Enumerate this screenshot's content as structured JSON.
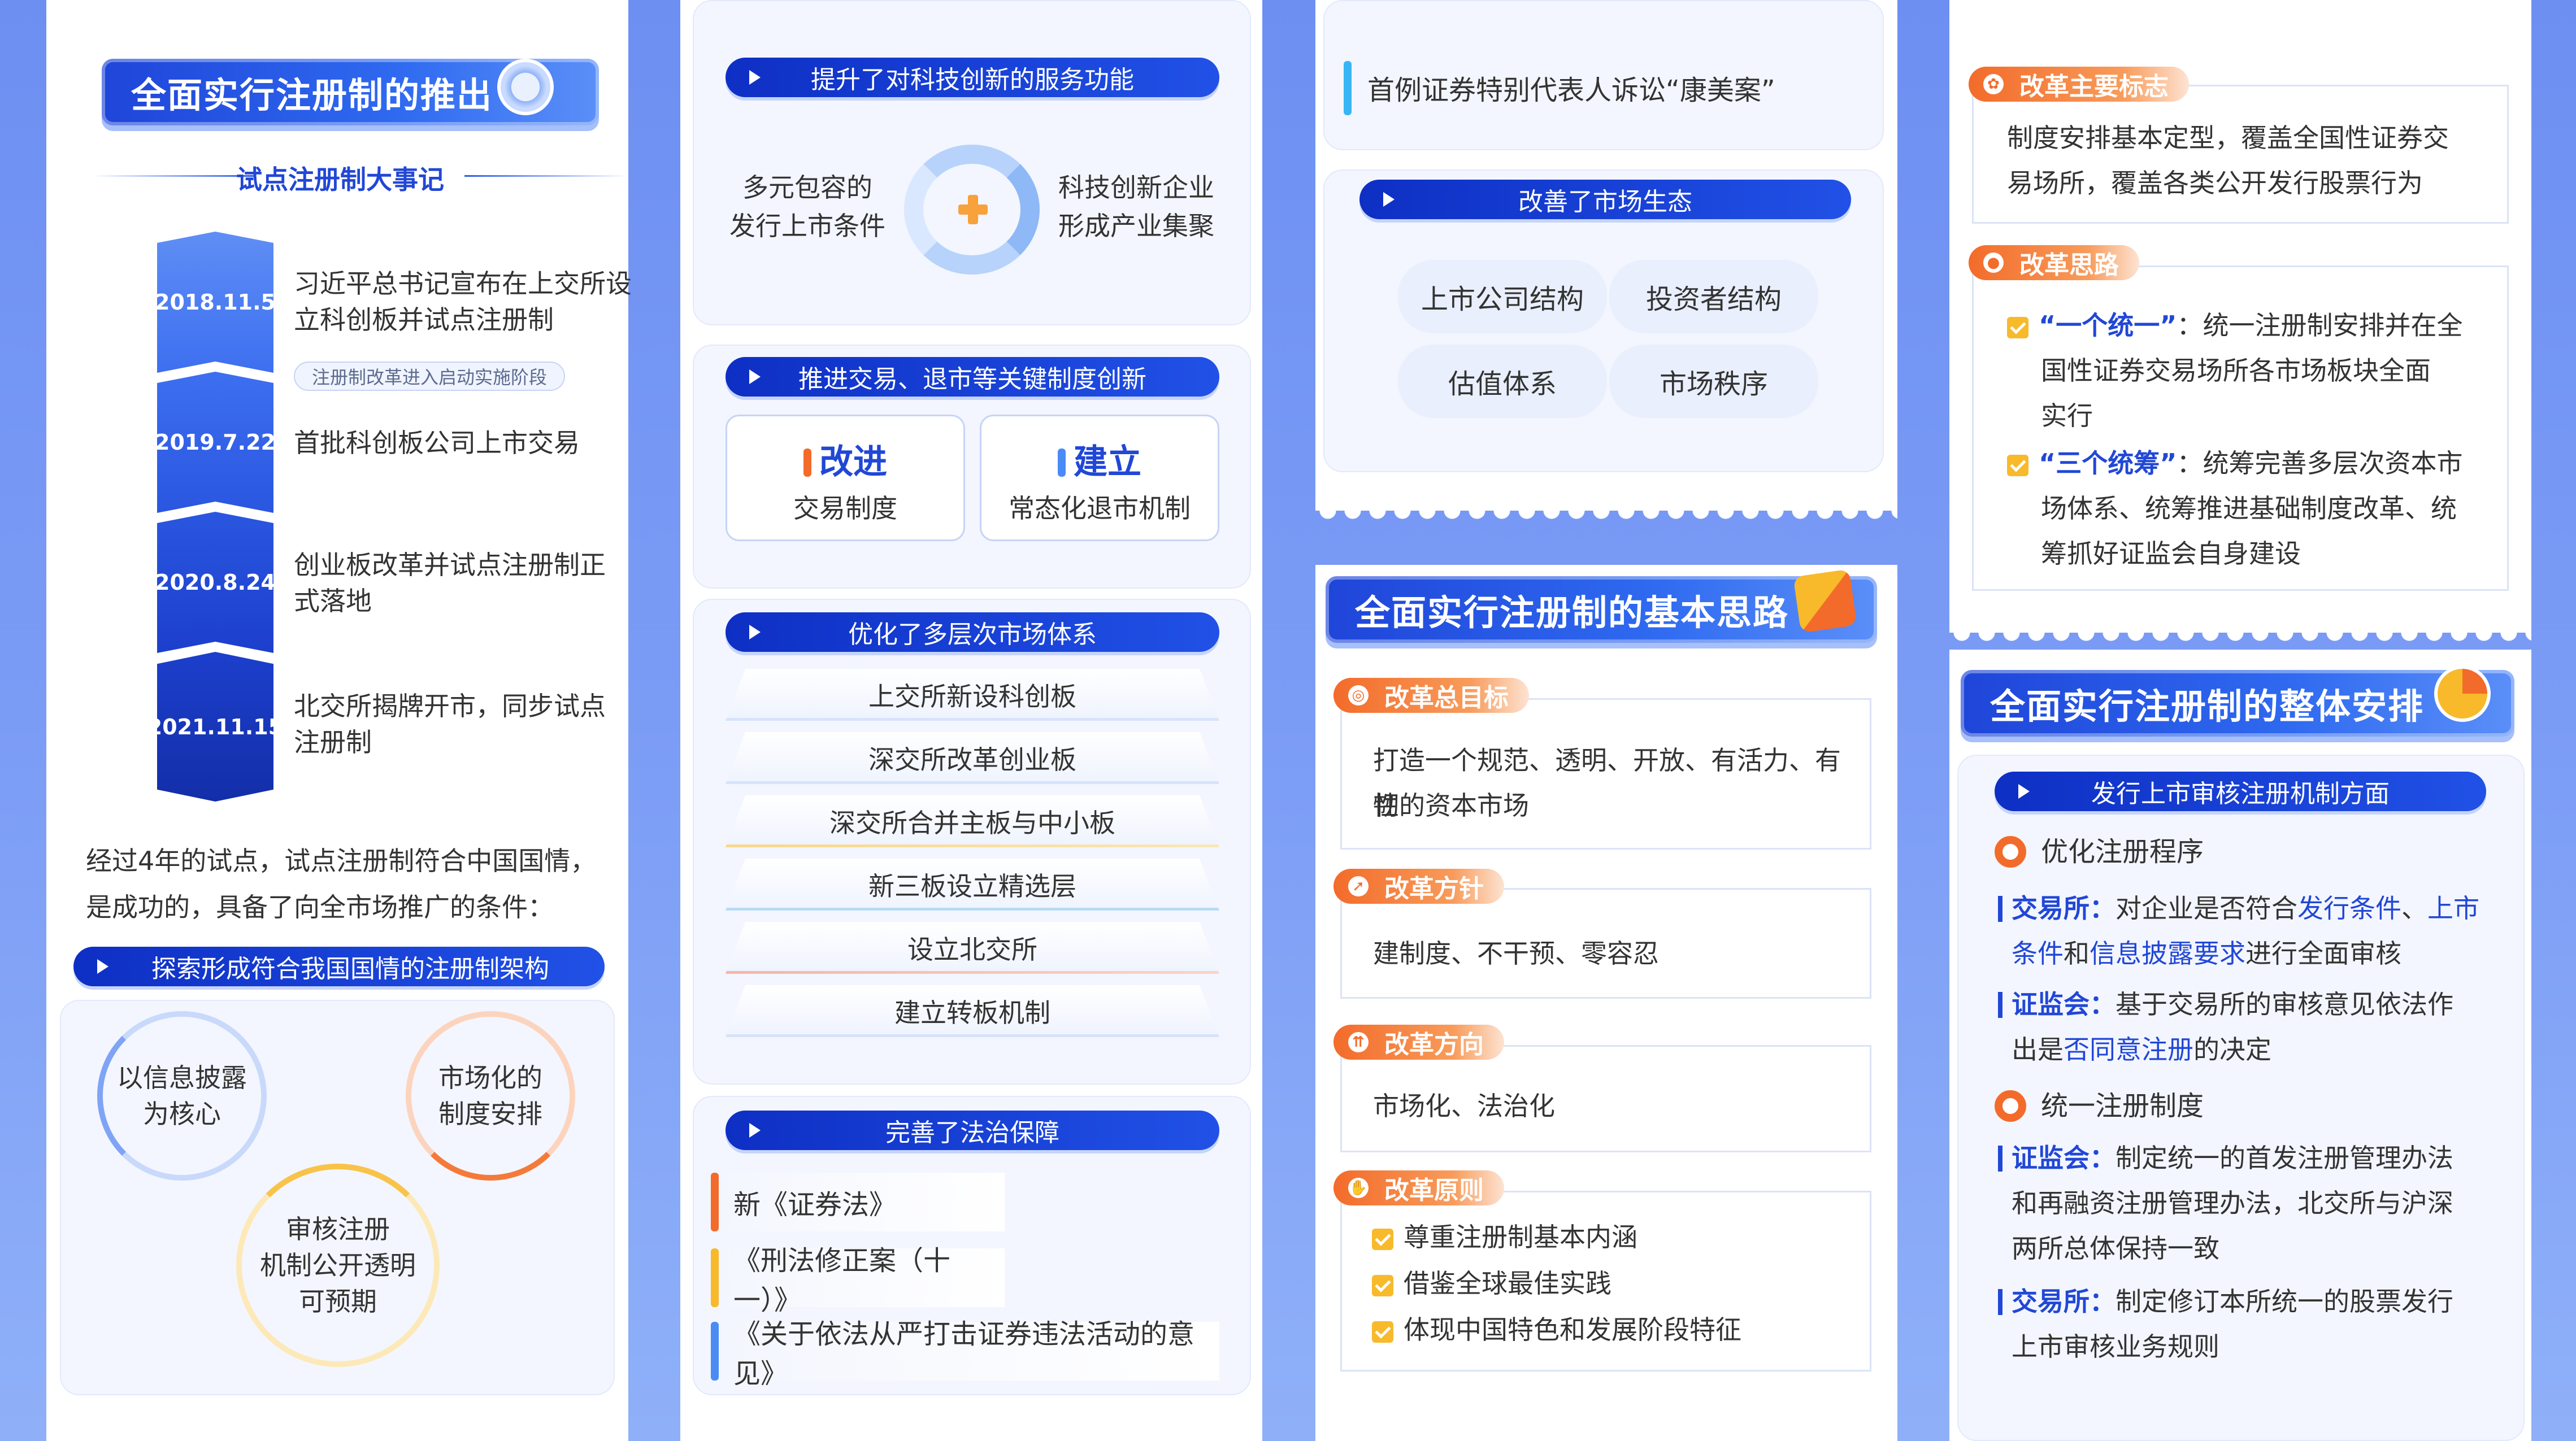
{
  "col1": {
    "banner": "全面实行注册制的推出",
    "subtitle": "试点注册制大事记",
    "timeline": [
      {
        "date": "2018.11.5",
        "text": "习近平总书记宣布在上交所设立科创板并试点注册制",
        "note": "注册制改革进入启动实施阶段"
      },
      {
        "date": "2019.7.22",
        "text": "首批科创板公司上市交易"
      },
      {
        "date": "2020.8.24",
        "text": "创业板改革并试点注册制正式落地"
      },
      {
        "date": "2021.11.15",
        "text": "北交所揭牌开市，同步试点注册制"
      }
    ],
    "summary_line1": "经过4年的试点，试点注册制符合中国国情，",
    "summary_line2": "是成功的，具备了向全市场推广的条件：",
    "pill": "探索形成符合我国国情的注册制架构",
    "circles": [
      {
        "line1": "以信息披露",
        "line2": "为核心"
      },
      {
        "line1": "市场化的",
        "line2": "制度安排"
      },
      {
        "line1": "审核注册",
        "line2": "机制公开透明",
        "line3": "可预期"
      }
    ]
  },
  "col2": {
    "pill1": "提升了对科技创新的服务功能",
    "left_text1": "多元包容的",
    "left_text2": "发行上市条件",
    "right_text1": "科技创新企业",
    "right_text2": "形成产业集聚",
    "pill2": "推进交易、退市等关键制度创新",
    "box1_title": "改进",
    "box1_sub": "交易制度",
    "box2_title": "建立",
    "box2_sub": "常态化退市机制",
    "pill3": "优化了多层次市场体系",
    "stairs": [
      "上交所新设科创板",
      "深交所改革创业板",
      "深交所合并主板与中小板",
      "新三板设立精选层",
      "设立北交所",
      "建立转板机制"
    ],
    "pill4": "完善了法治保障",
    "laws": [
      "新《证券法》",
      "《刑法修正案（十一）》",
      "《关于依法从严打击证券违法活动的意见》"
    ]
  },
  "col3": {
    "case": "首例证券特别代表人诉讼“康美案”",
    "pill": "改善了市场生态",
    "eco": [
      "上市公司结构",
      "投资者结构",
      "估值体系",
      "市场秩序"
    ],
    "banner": "全面实行注册制的基本思路",
    "goal_tag": "改革总目标",
    "goal_text1": "打造一个规范、透明、开放、有活力、有韧",
    "goal_text2": "性的资本市场",
    "policy_tag": "改革方针",
    "policy_text": "建制度、不干预、零容忍",
    "direction_tag": "改革方向",
    "direction_text": "市场化、法治化",
    "principle_tag": "改革原则",
    "principles": [
      "尊重注册制基本内涵",
      "借鉴全球最佳实践",
      "体现中国特色和发展阶段特征"
    ]
  },
  "col4": {
    "mark_tag": "改革主要标志",
    "mark_text1": "制度安排基本定型，覆盖全国性证券交",
    "mark_text2": "易场所，覆盖各类公开发行股票行为",
    "idea_tag": "改革思路",
    "idea1_key": "“一个统一”",
    "idea1_text1": "：统一注册制安排并在全",
    "idea1_text2": "国性证券交易场所各市场板块全面",
    "idea1_text3": "实行",
    "idea2_key": "“三个统筹”",
    "idea2_text1": "：统筹完善多层次资本市",
    "idea2_text2": "场体系、统筹推进基础制度改革、统",
    "idea2_text3": "筹抓好证监会自身建设",
    "banner": "全面实行注册制的整体安排",
    "pill": "发行上市审核注册机制方面",
    "sec1": "优化注册程序",
    "ex_key": "交易所：",
    "ex_t1": "对企业是否符合",
    "ex_h1": "发行条件",
    "ex_t2": "、",
    "ex_h2": "上市",
    "ex_h3": "条件",
    "ex_t3": "和",
    "ex_h4": "信息披露要求",
    "ex_t4": "进行全面审核",
    "csrc_key": "证监会：",
    "csrc_t1": "基于交易所的审核意见依法作",
    "csrc_t2": "出是",
    "csrc_h": "否同意注册",
    "csrc_t3": "的决定",
    "sec2": "统一注册制度",
    "csrc2_key": "证监会：",
    "csrc2_t1": "制定统一的首发注册管理办法",
    "csrc2_t2": "和再融资注册管理办法，北交所与沪深",
    "csrc2_t3": "两所总体保持一致",
    "ex2_key": "交易所：",
    "ex2_t1": "制定修订本所统一的股票发行",
    "ex2_t2": "上市审核业务规则"
  },
  "colors": {
    "primary": "#2147d6",
    "accent_orange": "#f36b2a",
    "check_yellow": "#f8b92b"
  }
}
